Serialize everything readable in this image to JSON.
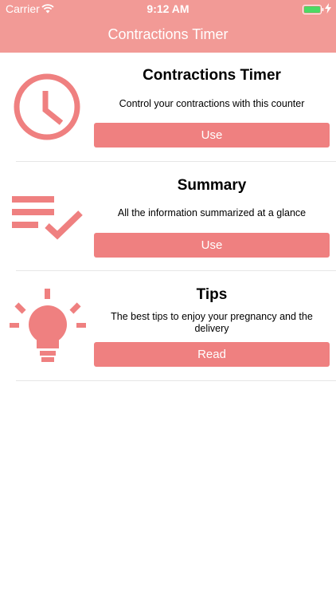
{
  "status_bar": {
    "carrier": "Carrier",
    "time": "9:12 AM",
    "icons": [
      "wifi-icon",
      "battery-icon",
      "charging-icon"
    ]
  },
  "nav": {
    "title": "Contractions Timer"
  },
  "colors": {
    "header": "#f29a96",
    "accent": "#ef8080",
    "battery": "#4cd964"
  },
  "features": [
    {
      "icon": "clock-icon",
      "title": "Contractions Timer",
      "description": "Control your contractions with this counter",
      "button": "Use"
    },
    {
      "icon": "checklist-icon",
      "title": "Summary",
      "description": "All the information summarized at a glance",
      "button": "Use"
    },
    {
      "icon": "lightbulb-icon",
      "title": "Tips",
      "description": "The best tips to enjoy your pregnancy and the delivery",
      "button": "Read"
    }
  ]
}
